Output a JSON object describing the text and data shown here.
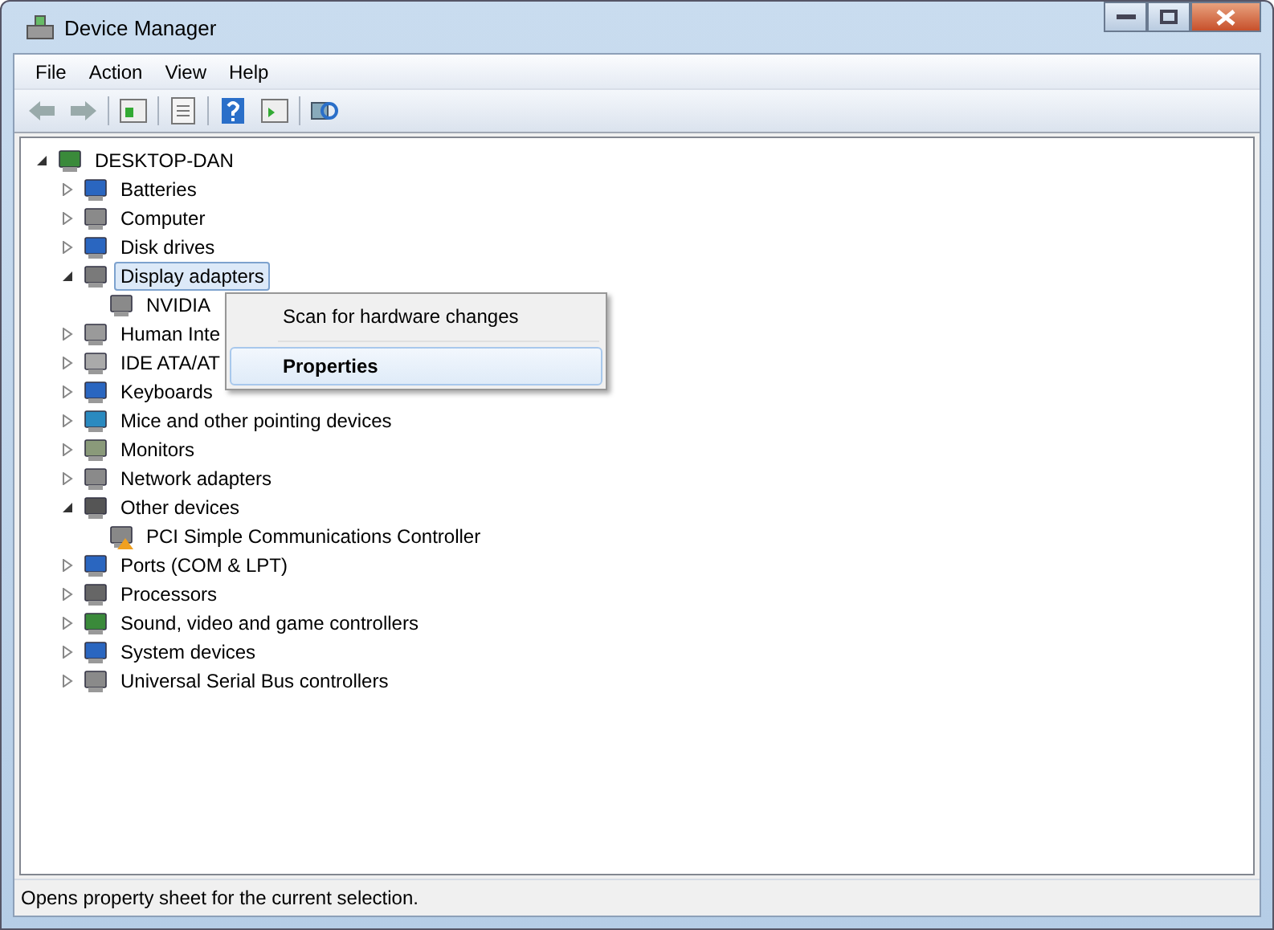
{
  "window": {
    "title": "Device Manager"
  },
  "menu": [
    "File",
    "Action",
    "View",
    "Help"
  ],
  "tree": {
    "label": "DESKTOP-DAN",
    "expanded": true,
    "children": [
      {
        "label": "Batteries",
        "expanded": false
      },
      {
        "label": "Computer",
        "expanded": false
      },
      {
        "label": "Disk drives",
        "expanded": false
      },
      {
        "label": "Display adapters",
        "expanded": true,
        "selected": true,
        "children": [
          {
            "label": "NVIDIA",
            "selected": false
          }
        ]
      },
      {
        "label": "Human Inte",
        "expanded": false
      },
      {
        "label": "IDE ATA/AT",
        "expanded": false
      },
      {
        "label": "Keyboards",
        "expanded": false
      },
      {
        "label": "Mice and other pointing devices",
        "expanded": false
      },
      {
        "label": "Monitors",
        "expanded": false
      },
      {
        "label": "Network adapters",
        "expanded": false
      },
      {
        "label": "Other devices",
        "expanded": true,
        "children": [
          {
            "label": "PCI Simple Communications Controller",
            "selected": false,
            "warning": true
          }
        ]
      },
      {
        "label": "Ports (COM & LPT)",
        "expanded": false
      },
      {
        "label": "Processors",
        "expanded": false
      },
      {
        "label": "Sound, video and game controllers",
        "expanded": false
      },
      {
        "label": "System devices",
        "expanded": false
      },
      {
        "label": "Universal Serial Bus controllers",
        "expanded": false
      }
    ]
  },
  "context_menu": [
    {
      "label": "Scan for hardware changes",
      "selected": false
    },
    {
      "label": "Properties",
      "selected": true
    }
  ],
  "status_bar": "Opens property sheet for the current selection."
}
